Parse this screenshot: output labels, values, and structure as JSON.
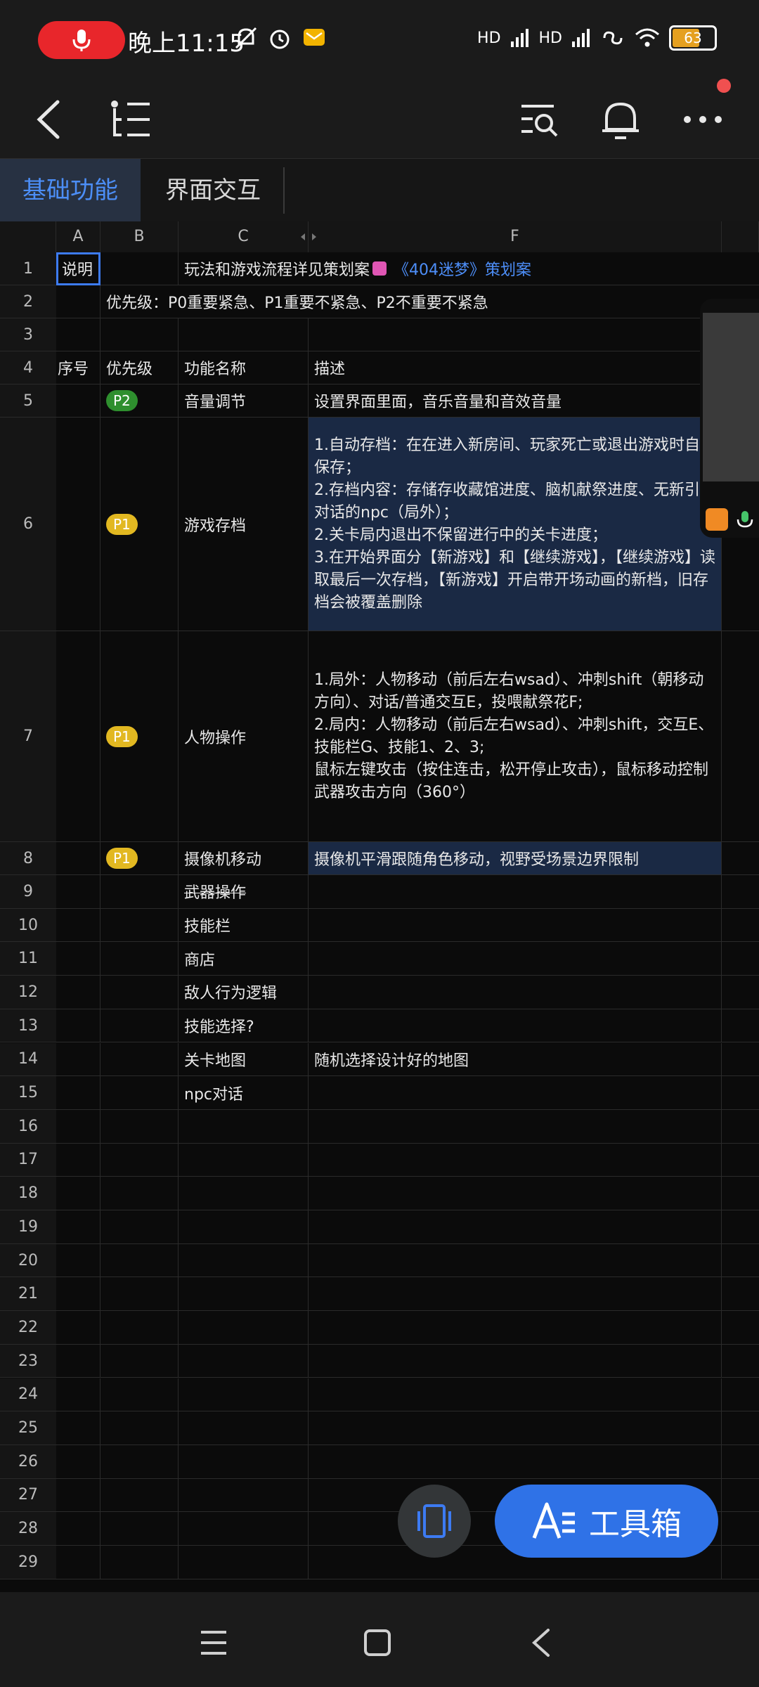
{
  "status": {
    "time": "晚上11:15",
    "battery": "63",
    "signal_labels": [
      "HD",
      "HD"
    ]
  },
  "tabs": [
    {
      "label": "基础功能",
      "active": true
    },
    {
      "label": "界面交互",
      "active": false
    }
  ],
  "columns": [
    "A",
    "B",
    "C",
    "F"
  ],
  "row_numbers": [
    "1",
    "2",
    "3",
    "4",
    "5",
    "6",
    "7",
    "8",
    "9",
    "10",
    "11",
    "12",
    "13",
    "14",
    "15",
    "16",
    "17",
    "18",
    "19",
    "20",
    "21",
    "22",
    "23",
    "24",
    "25",
    "26",
    "27",
    "28",
    "29"
  ],
  "rows": {
    "r1": {
      "a": "说明",
      "c": "玩法和游戏流程详见策划案",
      "link": "《404迷梦》策划案"
    },
    "r2": {
      "b": "优先级：P0重要紧急、P1重要不紧急、P2不重要不紧急"
    },
    "r4": {
      "a": "序号",
      "b": "优先级",
      "c": "功能名称",
      "f": "描述"
    },
    "r5": {
      "b": "P2",
      "c": "音量调节",
      "f": "设置界面里面，音乐音量和音效音量"
    },
    "r6": {
      "b": "P1",
      "c": "游戏存档",
      "f": "1.自动存档：在在进入新房间、玩家死亡或退出游戏时自动保存；\n2.存档内容：存储存收藏馆进度、脑机献祭进度、无新引导对话的npc（局外）；\n2.关卡局内退出不保留进行中的关卡进度；\n3.在开始界面分【新游戏】和【继续游戏】，【继续游戏】读取最后一次存档，【新游戏】开启带开场动画的新档，旧存档会被覆盖删除"
    },
    "r7": {
      "b": "P1",
      "c": "人物操作",
      "f": "1.局外：人物移动（前后左右wsad）、冲刺shift（朝移动方向）、对话/普通交互E，投喂献祭花F;\n2.局内：人物移动（前后左右wsad）、冲刺shift，交互E、技能栏G、技能1、2、3;\n鼠标左键攻击（按住连击，松开停止攻击），鼠标移动控制武器攻击方向（360°）"
    },
    "r8": {
      "b": "P1",
      "c": "摄像机移动",
      "f": "摄像机平滑跟随角色移动，视野受场景边界限制"
    },
    "r9": {
      "c": "武器操作"
    },
    "r10": {
      "c": "技能栏"
    },
    "r11": {
      "c": "商店"
    },
    "r12": {
      "c": "敌人行为逻辑"
    },
    "r13": {
      "c": "技能选择?"
    },
    "r14": {
      "c": "关卡地图",
      "f": "随机选择设计好的地图"
    },
    "r15": {
      "c": "npc对话"
    }
  },
  "toolbox": {
    "label": "工具箱"
  },
  "colors": {
    "accent": "#2f72e7",
    "selection": "#3d7bf2",
    "p1": "#e2b821",
    "p2": "#2e8f2e",
    "highlight": "#1a2944"
  }
}
